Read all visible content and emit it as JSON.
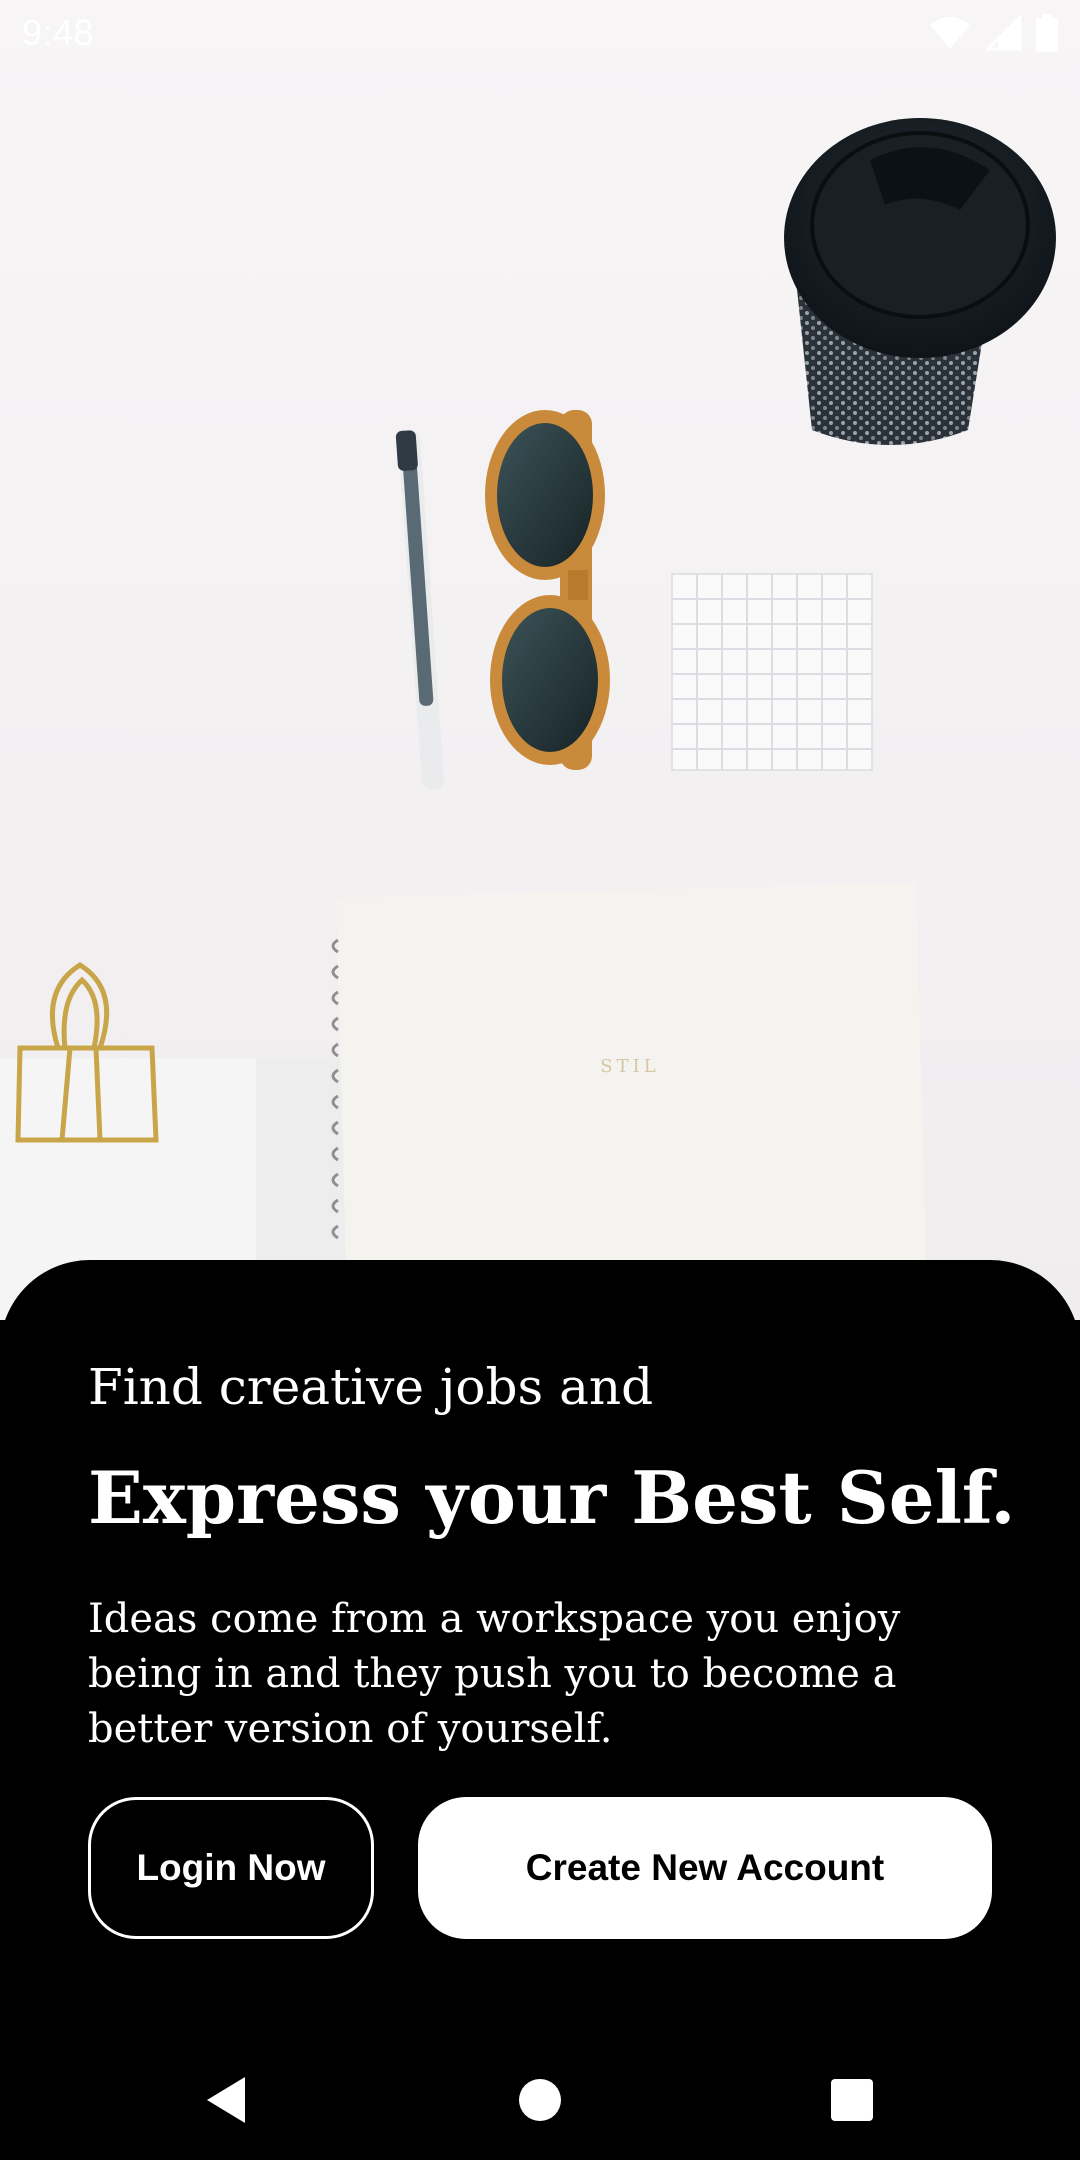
{
  "status_bar": {
    "time": "9:48",
    "icons": [
      "wifi-icon",
      "cell-signal-icon",
      "battery-icon"
    ]
  },
  "hero": {
    "notebook_brand": "STIL"
  },
  "sheet": {
    "subtitle": "Find creative jobs and",
    "title": "Express your Best Self.",
    "body": "Ideas come from a workspace you enjoy being in and they push you to become a better version of yourself."
  },
  "buttons": {
    "login_label": "Login Now",
    "create_label": "Create New Account"
  },
  "nav": {
    "items": [
      "back-icon",
      "home-icon",
      "recents-icon"
    ]
  },
  "colors": {
    "sheet_background": "#000000",
    "primary_text": "#ffffff",
    "create_button_background": "#ffffff",
    "create_button_text": "#000000"
  }
}
